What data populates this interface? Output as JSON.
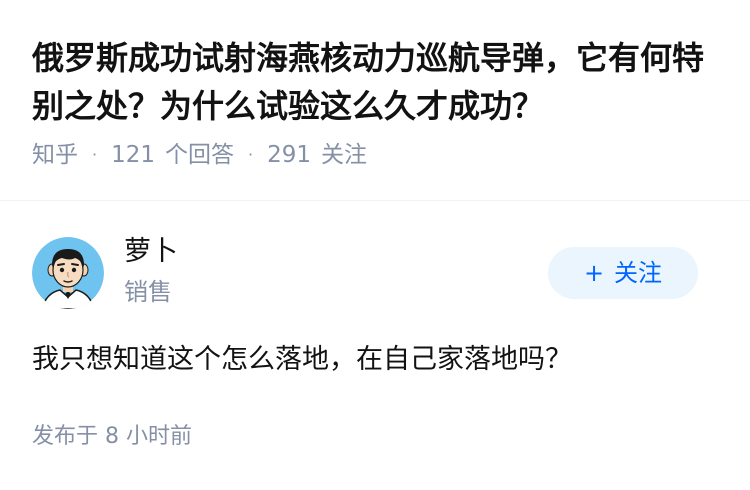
{
  "question": {
    "title": "俄罗斯成功试射海燕核动力巡航导弹，它有何特别之处？为什么试验这么久才成功？",
    "source": "知乎",
    "answers_count": "121",
    "answers_label": "个回答",
    "followers_count": "291",
    "followers_label": "关注",
    "separator": "·"
  },
  "author": {
    "name": "萝卜",
    "headline": "销售",
    "avatar_icon": "cartoon-person-avatar"
  },
  "follow_button": {
    "icon": "+",
    "label": "关注"
  },
  "answer": {
    "content": "我只想知道这个怎么落地，在自己家落地吗？",
    "publish_time": "发布于 8 小时前"
  },
  "colors": {
    "title": "#121212",
    "meta": "#8590a6",
    "accent": "#0066ff",
    "button_bg": "#ebf5fd",
    "avatar_bg": "#6fc3ef"
  }
}
